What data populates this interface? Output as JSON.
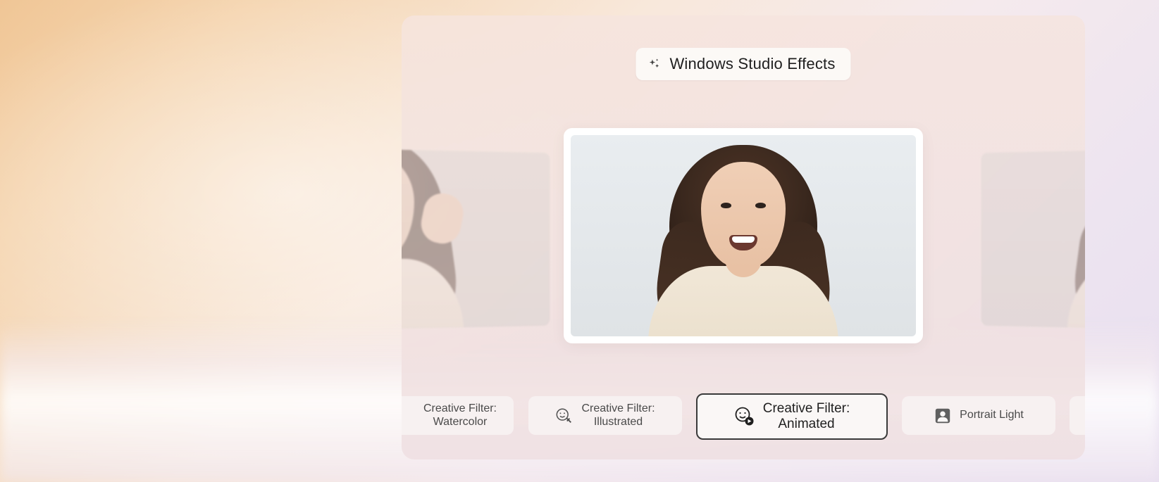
{
  "header": {
    "title": "Windows Studio Effects"
  },
  "filters": {
    "watercolor": {
      "line1": "Creative Filter:",
      "line2": "Watercolor"
    },
    "illustrated": {
      "line1": "Creative Filter:",
      "line2": "Illustrated"
    },
    "animated": {
      "line1": "Creative Filter:",
      "line2": "Animated"
    },
    "portrait": {
      "label": "Portrait Light"
    }
  }
}
